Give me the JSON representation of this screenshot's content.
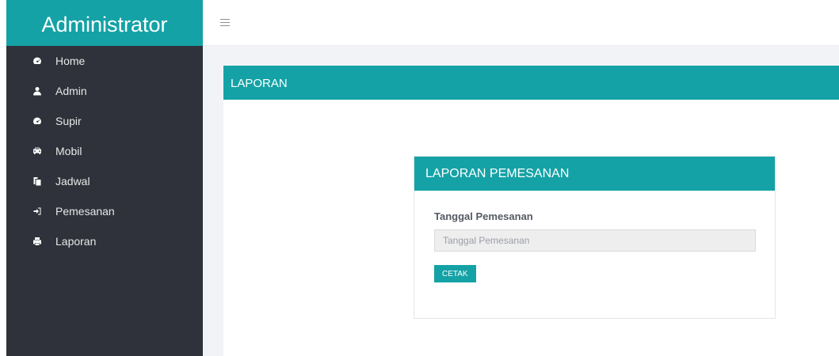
{
  "sidebar": {
    "brand": "Administrator",
    "items": [
      {
        "label": "Home",
        "icon": "dashboard-icon"
      },
      {
        "label": "Admin",
        "icon": "user-icon"
      },
      {
        "label": "Supir",
        "icon": "dashboard-icon"
      },
      {
        "label": "Mobil",
        "icon": "car-icon"
      },
      {
        "label": "Jadwal",
        "icon": "copy-icon"
      },
      {
        "label": "Pemesanan",
        "icon": "sign-in-icon"
      },
      {
        "label": "Laporan",
        "icon": "print-icon"
      }
    ]
  },
  "topbar": {
    "menu_icon": "bars-icon"
  },
  "main": {
    "panel_title": "LAPORAN",
    "card": {
      "title": "LAPORAN PEMESANAN",
      "field_label": "Tanggal Pemesanan",
      "field_placeholder": "Tanggal Pemesanan",
      "field_value": "",
      "button_label": "CETAK"
    }
  },
  "colors": {
    "accent": "#14a2a6",
    "sidebar_bg": "#2f323a",
    "content_bg": "#f2f3f7"
  }
}
